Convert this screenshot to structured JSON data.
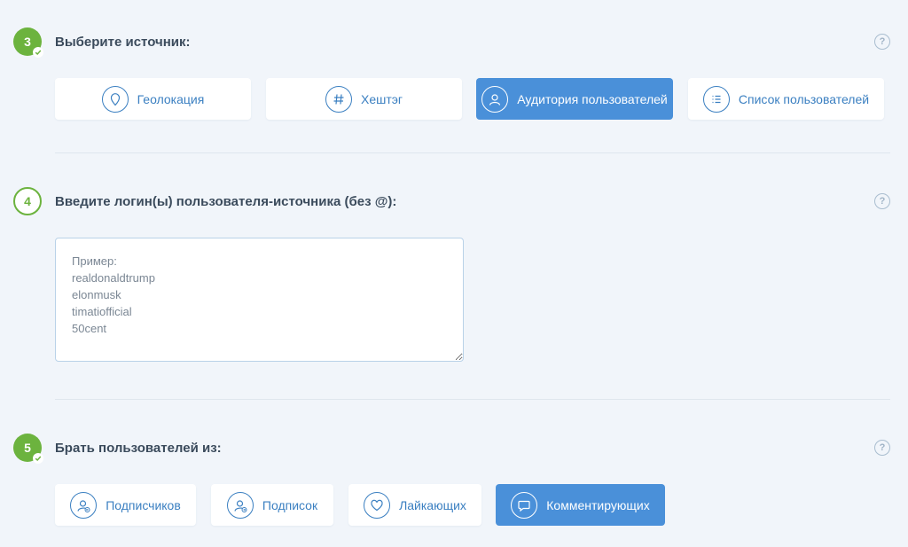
{
  "step3": {
    "number": "3",
    "title": "Выберите источник:",
    "help": "?",
    "options": [
      {
        "label": "Геолокация",
        "icon": "location-pin-icon"
      },
      {
        "label": "Хештэг",
        "icon": "hashtag-icon"
      },
      {
        "label": "Аудитория пользователей",
        "icon": "user-audience-icon",
        "active": true
      },
      {
        "label": "Список пользователей",
        "icon": "list-icon"
      }
    ]
  },
  "step4": {
    "number": "4",
    "title": "Введите логин(ы) пользователя-источника (без @):",
    "help": "?",
    "textarea_placeholder": "Пример:\nrealdonaldtrump\nelonmusk\ntimatiofficial\n50cent"
  },
  "step5": {
    "number": "5",
    "title": "Брать пользователей из:",
    "help": "?",
    "options": [
      {
        "label": "Подписчиков",
        "icon": "followers-icon"
      },
      {
        "label": "Подписок",
        "icon": "followings-icon"
      },
      {
        "label": "Лайкающих",
        "icon": "heart-icon"
      },
      {
        "label": "Комментирующих",
        "icon": "comment-icon",
        "active": true
      }
    ]
  },
  "colors": {
    "accent": "#4a90d9",
    "success": "#6cb33e",
    "background": "#f1f5fa"
  }
}
